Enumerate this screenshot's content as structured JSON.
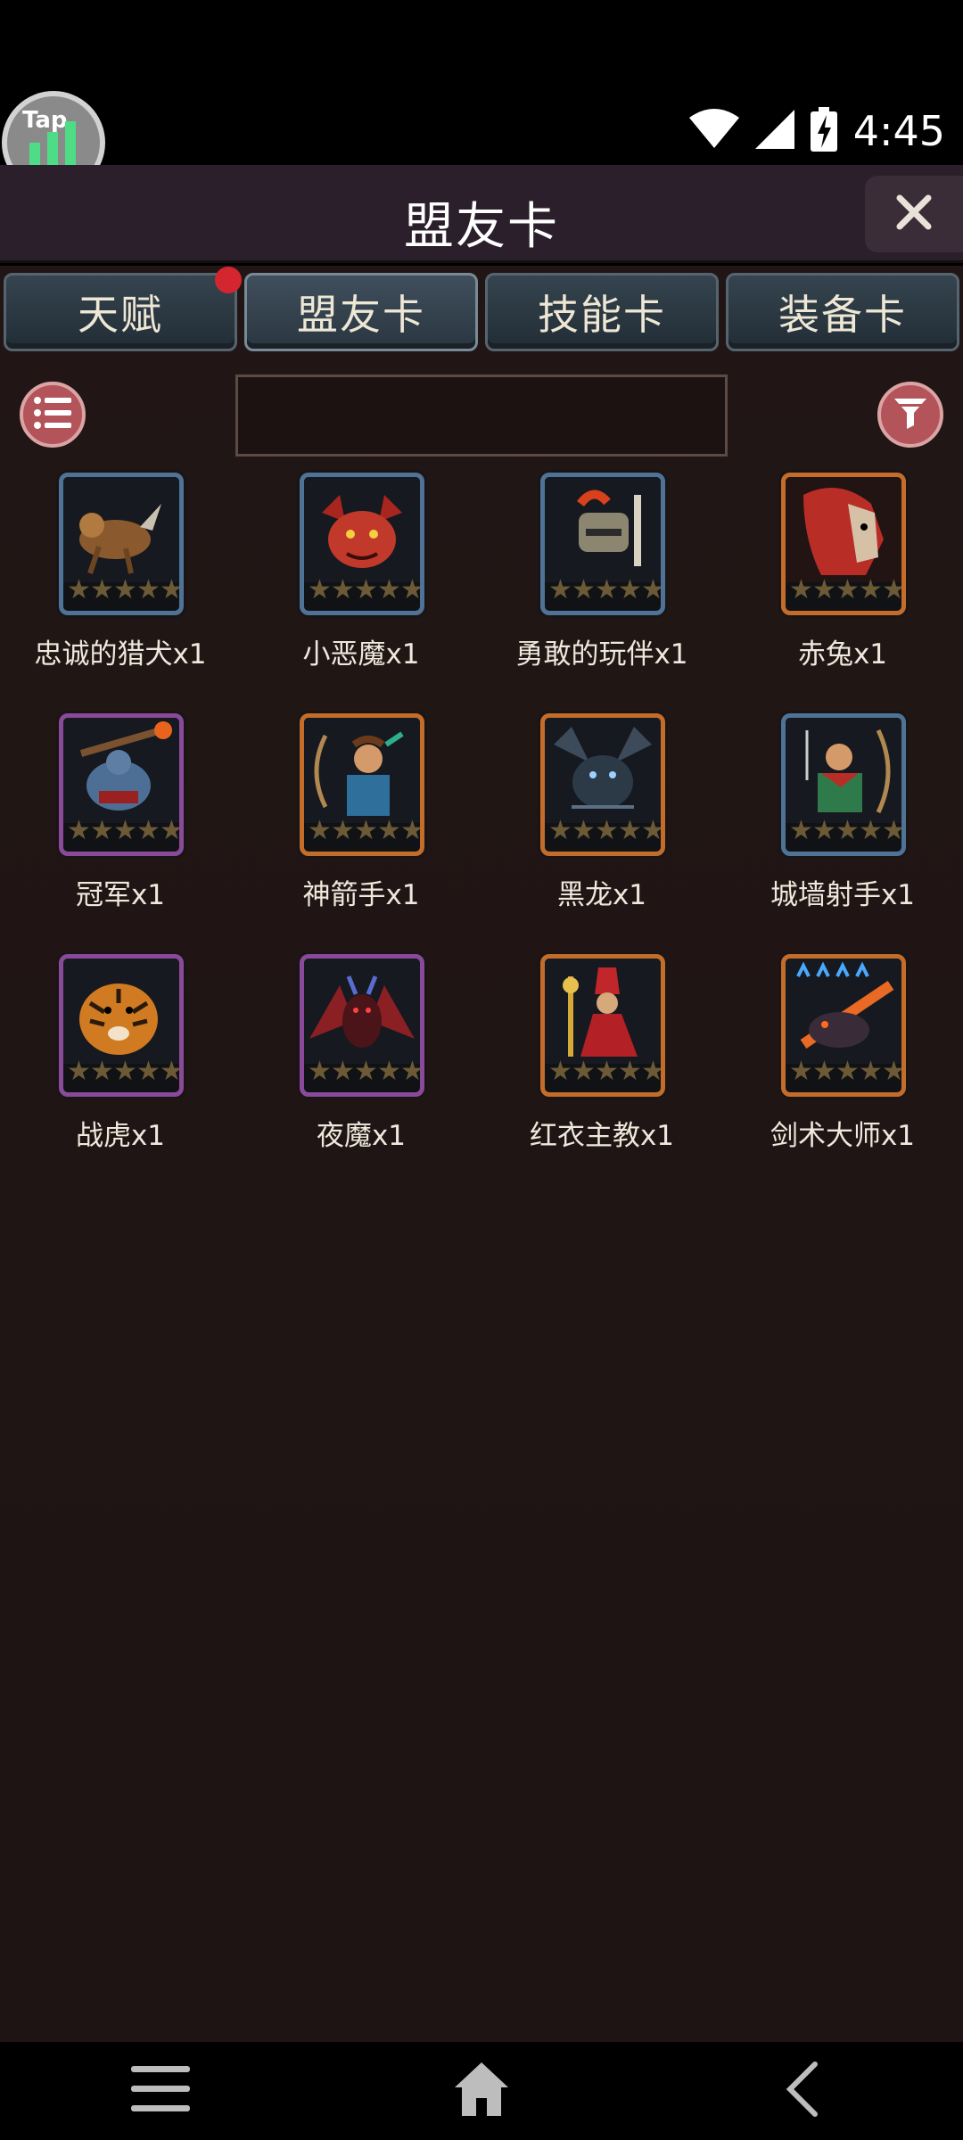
{
  "status_bar": {
    "time": "4:45"
  },
  "app_badge": {
    "label": "Tap"
  },
  "header": {
    "title": "盟友卡"
  },
  "tabs": [
    {
      "label": "天赋",
      "notification": true
    },
    {
      "label": "盟友卡",
      "active": true
    },
    {
      "label": "技能卡"
    },
    {
      "label": "装备卡"
    }
  ],
  "search": {
    "value": "",
    "placeholder": ""
  },
  "cards": [
    {
      "name": "忠诚的猎犬x1",
      "frame": "rare"
    },
    {
      "name": "小恶魔x1",
      "frame": "rare"
    },
    {
      "name": "勇敢的玩伴x1",
      "frame": "rare"
    },
    {
      "name": "赤兔x1",
      "frame": "legend"
    },
    {
      "name": "冠军x1",
      "frame": "epic"
    },
    {
      "name": "神箭手x1",
      "frame": "legend"
    },
    {
      "name": "黑龙x1",
      "frame": "legend"
    },
    {
      "name": "城墙射手x1",
      "frame": "rare"
    },
    {
      "name": "战虎x1",
      "frame": "epic"
    },
    {
      "name": "夜魔x1",
      "frame": "epic"
    },
    {
      "name": "红衣主教x1",
      "frame": "legend"
    },
    {
      "name": "剑术大师x1",
      "frame": "legend"
    }
  ],
  "colors": {
    "rare": "#4e7396",
    "epic": "#8a4a9a",
    "legend": "#c46c2a",
    "accent_red": "#d3262f",
    "round_button": "#b3545a"
  },
  "icons": [
    "wifi-icon",
    "signal-icon",
    "battery-charging-icon",
    "close-icon",
    "list-icon",
    "filter-icon",
    "menu-icon",
    "home-icon",
    "back-icon"
  ]
}
